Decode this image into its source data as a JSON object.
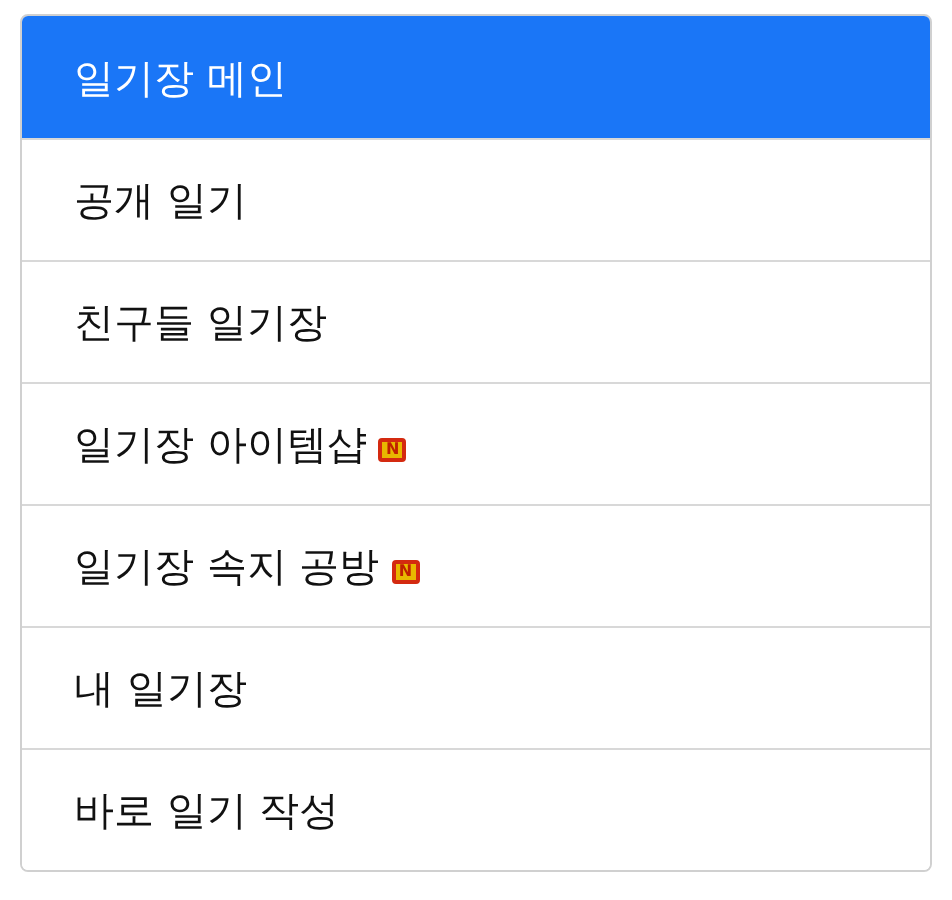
{
  "menu": [
    {
      "label": "일기장 메인",
      "selected": true
    },
    {
      "label": "공개 일기",
      "selected": false
    },
    {
      "label": "친구들 일기장",
      "selected": false
    },
    {
      "label": "일기장 아이템샵",
      "selected": false,
      "badge": "N"
    },
    {
      "label": "일기장 속지 공방",
      "selected": false,
      "badge": "N"
    },
    {
      "label": "내 일기장",
      "selected": false
    },
    {
      "label": "바로 일기 작성",
      "selected": false
    }
  ]
}
